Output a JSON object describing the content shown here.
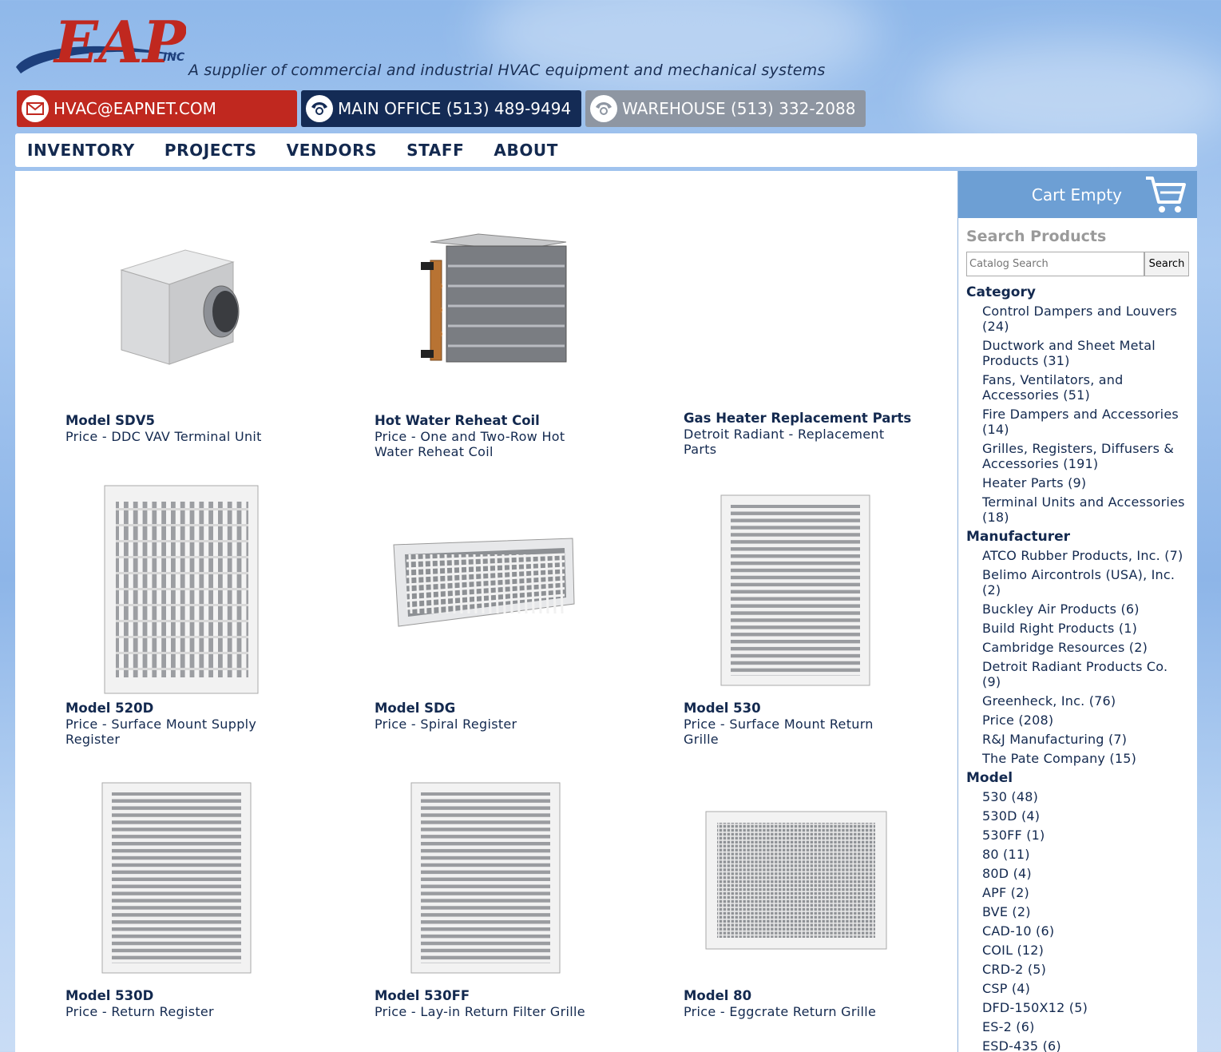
{
  "header": {
    "logo_text": "EAP",
    "logo_sub": "INC",
    "tagline": "A supplier of commercial and industrial HVAC equipment and mechanical systems",
    "email": "HVAC@EAPNET.COM",
    "main_office": "MAIN OFFICE (513) 489-9494",
    "warehouse": "WAREHOUSE (513) 332-2088"
  },
  "nav": [
    "INVENTORY",
    "PROJECTS",
    "VENDORS",
    "STAFF",
    "ABOUT"
  ],
  "products": [
    {
      "title": "Model SDV5",
      "desc": "Price - DDC VAV Terminal Unit",
      "icon": "vav-terminal-unit"
    },
    {
      "title": "Hot Water Reheat Coil",
      "desc": "Price - One and Two-Row Hot Water Reheat Coil",
      "icon": "reheat-coil"
    },
    {
      "title": "Gas Heater Replacement Parts",
      "desc": "Detroit Radiant - Replacement Parts",
      "icon": ""
    },
    {
      "title": "Model 520D",
      "desc": "Price - Surface Mount Supply Register",
      "icon": "supply-register"
    },
    {
      "title": "Model SDG",
      "desc": "Price - Spiral Register",
      "icon": "spiral-register"
    },
    {
      "title": "Model 530",
      "desc": "Price - Surface Mount Return Grille",
      "icon": "return-grille"
    },
    {
      "title": "Model 530D",
      "desc": "Price - Return Register",
      "icon": "return-register"
    },
    {
      "title": "Model 530FF",
      "desc": "Price - Lay-in Return Filter Grille",
      "icon": "filter-grille"
    },
    {
      "title": "Model 80",
      "desc": "Price - Eggcrate Return Grille",
      "icon": "eggcrate-grille"
    }
  ],
  "sidebar": {
    "cart_label": "Cart Empty",
    "search_heading": "Search Products",
    "search_placeholder": "Catalog Search",
    "search_button": "Search",
    "category_heading": "Category",
    "categories": [
      "Control Dampers and Louvers (24)",
      "Ductwork and Sheet Metal Products (31)",
      "Fans, Ventilators, and Accessories (51)",
      "Fire Dampers and Accessories (14)",
      "Grilles, Registers, Diffusers & Accessories (191)",
      "Heater Parts (9)",
      "Terminal Units and Accessories (18)"
    ],
    "manufacturer_heading": "Manufacturer",
    "manufacturers": [
      "ATCO Rubber Products, Inc. (7)",
      "Belimo Aircontrols (USA), Inc. (2)",
      "Buckley Air Products (6)",
      "Build Right Products (1)",
      "Cambridge Resources (2)",
      "Detroit Radiant Products Co. (9)",
      "Greenheck, Inc. (76)",
      "Price (208)",
      "R&J Manufacturing (7)",
      "The Pate Company (15)"
    ],
    "model_heading": "Model",
    "models": [
      "530 (48)",
      "530D (4)",
      "530FF (1)",
      "80 (11)",
      "80D (4)",
      "APF (2)",
      "BVE (2)",
      "CAD-10 (6)",
      "COIL (12)",
      "CRD-2 (5)",
      "CSP (4)",
      "DFD-150X12 (5)",
      "ES-2 (6)",
      "ESD-435 (6)"
    ]
  },
  "colors": {
    "red": "#c0281f",
    "navy": "#142b55",
    "gray": "#8e96a2",
    "cart_blue": "#6d9fd4",
    "text": "#13294f"
  }
}
